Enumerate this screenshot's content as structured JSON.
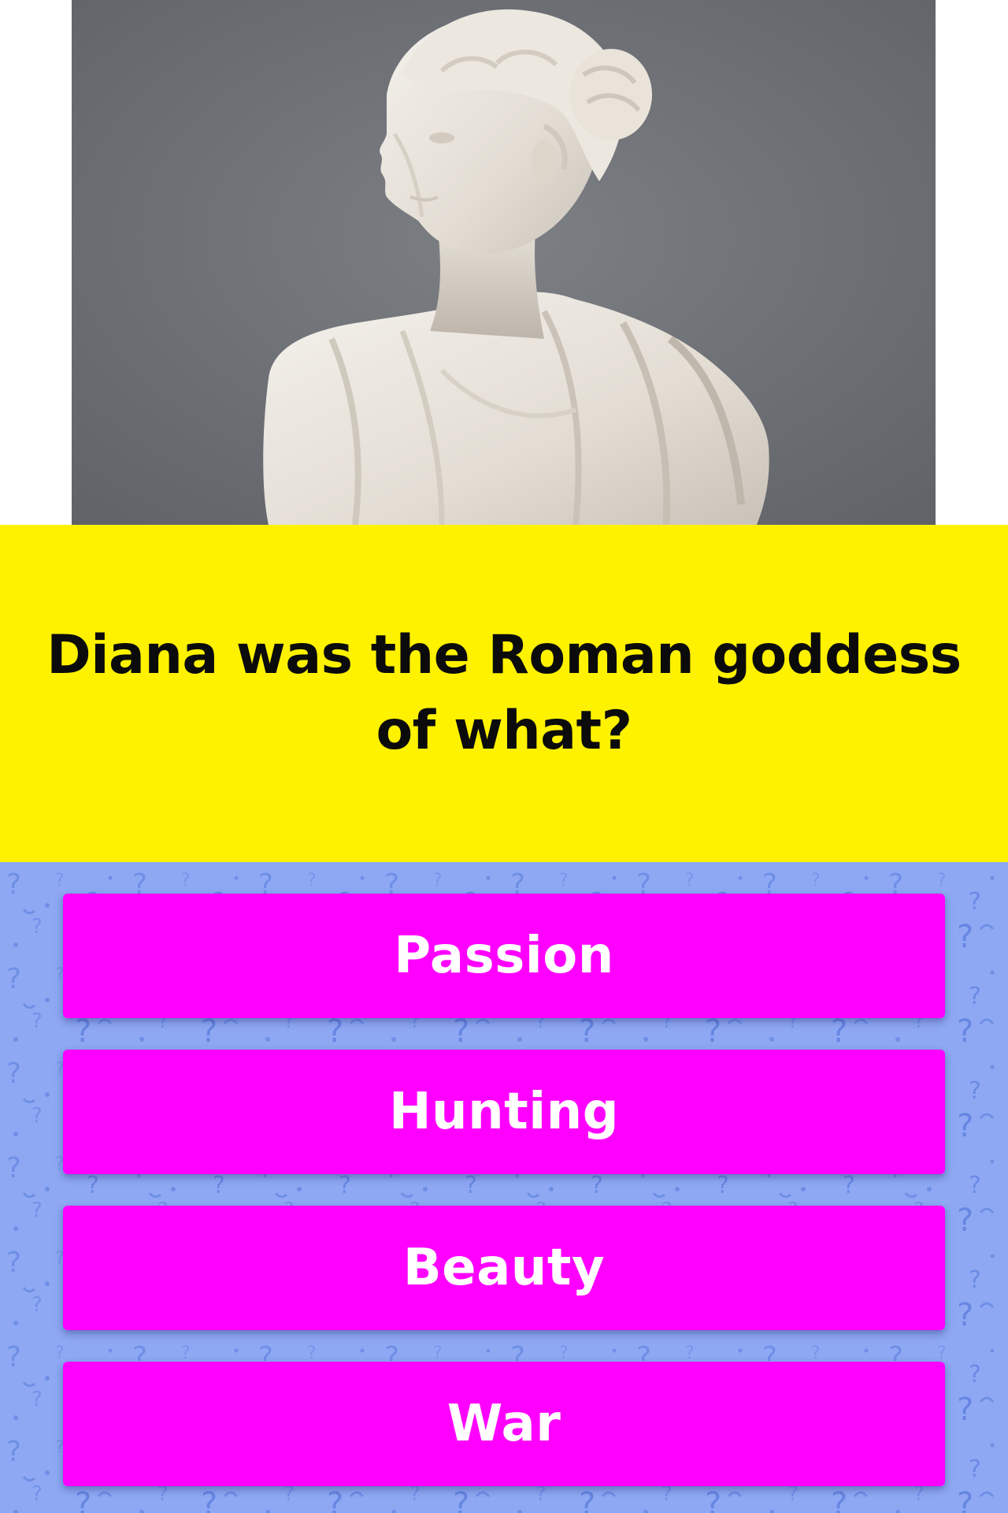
{
  "quiz": {
    "image": {
      "subject": "marble-bust-image",
      "background_color": "#6e7176"
    },
    "question": {
      "text": "Diana was the Roman goddess of what?",
      "band_color": "#fff200"
    },
    "answers": [
      {
        "label": "Passion"
      },
      {
        "label": "Hunting"
      },
      {
        "label": "Beauty"
      },
      {
        "label": "War"
      }
    ],
    "colors": {
      "answer_button": "#ff00ff",
      "answer_text": "#ffffff",
      "answers_background": "#8ea8f3",
      "pattern_glyph": "#6f8fe6"
    },
    "pattern_icon": "question-mark-pattern-icon"
  }
}
